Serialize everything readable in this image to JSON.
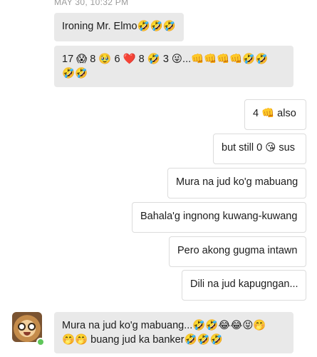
{
  "chat": {
    "timestamp": "MAY 30, 10:32 PM",
    "messages": [
      {
        "id": "m1",
        "direction": "incoming",
        "text": "Ironing Mr. Elmo🤣🤣🤣"
      },
      {
        "id": "m2",
        "direction": "incoming",
        "text": "17 😱 8 🥹 6 ❤️ 8 🤣 3 😜...👊👊👊👊🤣🤣🤣🤣"
      },
      {
        "id": "m3",
        "direction": "outgoing",
        "text": "4 👊 also"
      },
      {
        "id": "m4",
        "direction": "outgoing",
        "text": "but still 0 😘 sus"
      },
      {
        "id": "m5",
        "direction": "outgoing",
        "text": "Mura na jud ko'g mabuang"
      },
      {
        "id": "m6",
        "direction": "outgoing",
        "text": "Bahala'g ingnong kuwang-kuwang"
      },
      {
        "id": "m7",
        "direction": "outgoing",
        "text": "Pero akong gugma intawn"
      },
      {
        "id": "m8",
        "direction": "outgoing",
        "text": "Dili na jud kapugngan..."
      },
      {
        "id": "m9",
        "direction": "incoming",
        "text": "Mura na jud ko'g mabuang...🤣🤣😂😂😝🤭🤭🤭 buang jud ka banker🤣🤣🤣"
      }
    ]
  },
  "contact": {
    "avatar_icon": "monkey-avatar-icon",
    "online_status_color": "#5fc65a"
  }
}
